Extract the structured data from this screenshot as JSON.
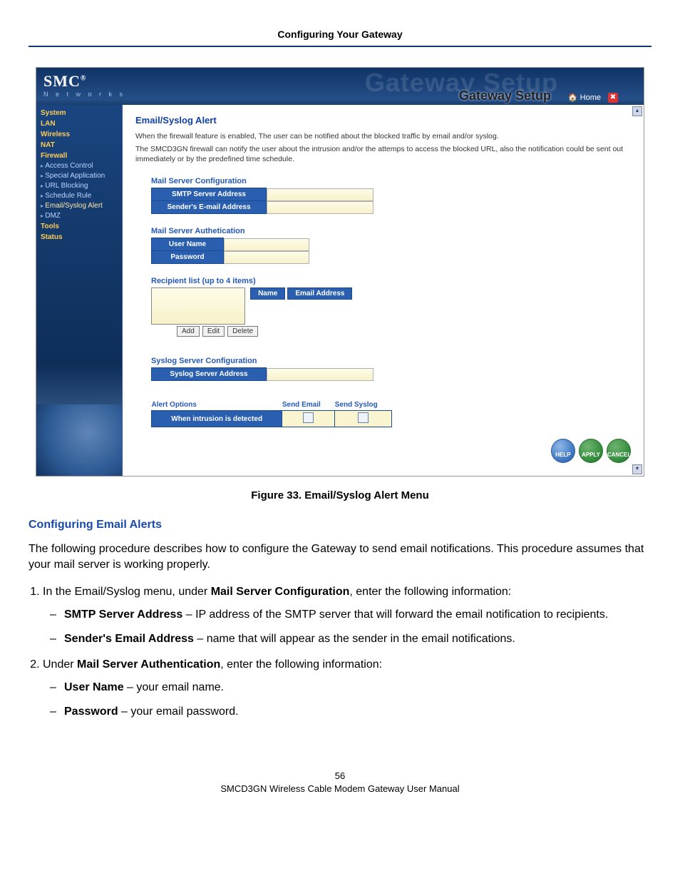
{
  "doc_header": "Configuring Your Gateway",
  "router": {
    "brand": "SMC",
    "brand_reg": "®",
    "brand_sub": "N e t w o r k s",
    "watermark": "Gateway Setup",
    "title": "Gateway Setup",
    "home": "Home",
    "sidebar": {
      "system": "System",
      "lan": "LAN",
      "wireless": "Wireless",
      "nat": "NAT",
      "firewall": "Firewall",
      "access": "Access Control",
      "special": "Special Application",
      "urlblock": "URL Blocking",
      "schedule": "Schedule Rule",
      "emailsyslog": "Email/Syslog Alert",
      "dmz": "DMZ",
      "tools": "Tools",
      "status": "Status"
    },
    "content": {
      "title": "Email/Syslog Alert",
      "p1": "When the firewall feature is enabled, The user can be notified about the blocked traffic by email and/or syslog.",
      "p2": "The SMCD3GN firewall can notify the user about the intrusion and/or the attemps to access the blocked URL, also the notification could be sent out immediately or by the predefined time schedule.",
      "mail_conf_head": "Mail Server Configuration",
      "smtp_label": "SMTP Server Address",
      "sender_label": "Sender's E-mail Address",
      "auth_head": "Mail Server Authetication",
      "user_label": "User Name",
      "pass_label": "Password",
      "recip_head": "Recipient list (up to 4 items)",
      "recip_cols": {
        "name": "Name",
        "email": "Email Address"
      },
      "btn_add": "Add",
      "btn_edit": "Edit",
      "btn_del": "Delete",
      "syslog_head": "Syslog Server Configuration",
      "syslog_label": "Syslog Server Address",
      "alert_head": "Alert Options",
      "col_send_email": "Send Email",
      "col_send_syslog": "Send Syslog",
      "row_intrusion": "When intrusion is detected",
      "btn_help": "HELP",
      "btn_apply": "APPLY",
      "btn_cancel": "CANCEL"
    }
  },
  "caption": "Figure 33. Email/Syslog Alert Menu",
  "section_title": "Configuring Email Alerts",
  "intro": "The following procedure describes how to configure the Gateway to send email notifications. This procedure assumes that your mail server is working properly.",
  "step1_pre": "In the Email/Syslog menu, under ",
  "step1_bold": "Mail Server Configuration",
  "step1_post": ", enter the following information:",
  "s1a_bold": "SMTP Server Address",
  "s1a_text": " – IP address of the SMTP server that will forward the email notification to recipients.",
  "s1b_bold": "Sender's Email Address",
  "s1b_text": " – name that will appear as the sender in the email notifications.",
  "step2_pre": "Under ",
  "step2_bold": "Mail Server Authentication",
  "step2_post": ", enter the following information:",
  "s2a_bold": "User Name",
  "s2a_text": " – your email name.",
  "s2b_bold": "Password",
  "s2b_text": " – your email password.",
  "page_no": "56",
  "footer": "SMCD3GN Wireless Cable Modem Gateway User Manual"
}
